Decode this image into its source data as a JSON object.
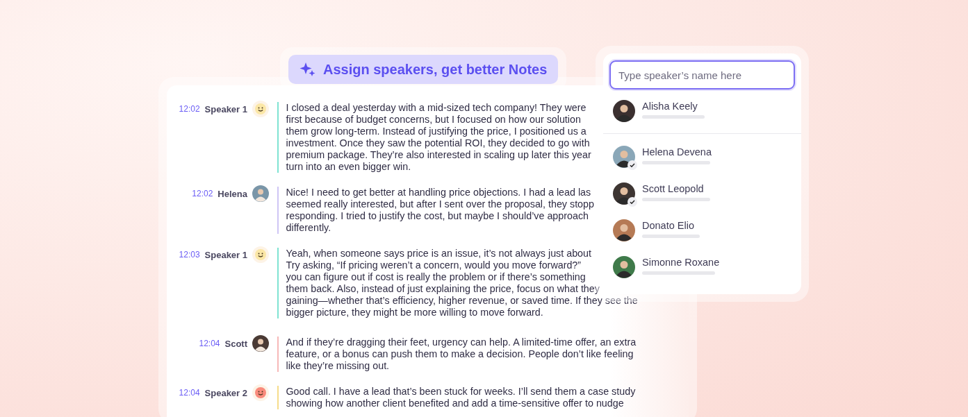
{
  "banner": {
    "text": "Assign speakers, get better Notes"
  },
  "transcript": [
    {
      "time": "12:02",
      "speaker": "Speaker 1",
      "avatar": {
        "kind": "emoji",
        "color": "#fbe7a6"
      },
      "color": "#7fe3d2",
      "lines": [
        "I closed a deal yesterday with a mid-sized tech company! They were",
        "first because of budget concerns, but I focused on how our solution",
        "them grow long-term. Instead of justifying the price, I positioned us a",
        "investment. Once they saw the potential ROI, they decided to go with",
        "premium package. They’re also interested in scaling up later this year",
        "turn into an even bigger win."
      ]
    },
    {
      "time": "12:02",
      "speaker": "Helena",
      "avatar": {
        "kind": "photo",
        "color": "#7a96a8"
      },
      "color": "#cfc6f5",
      "lines": [
        "Nice! I need to get better at handling price objections. I had a lead las",
        "seemed really interested, but after I sent over the proposal, they stopp",
        "responding. I tried to justify the cost, but maybe I should’ve approach",
        "differently."
      ]
    },
    {
      "time": "12:03",
      "speaker": "Speaker 1",
      "avatar": {
        "kind": "emoji",
        "color": "#fbe7a6"
      },
      "color": "#7fe3d2",
      "lines": [
        "Yeah, when someone says price is an issue, it’s not always just about",
        "Try asking, “If pricing weren’t a concern, would you move forward?”",
        "you can figure out if cost is really the problem or if there’s something",
        "them back. Also, instead of just explaining the price, focus on what they",
        "gaining—whether that’s efficiency, higher revenue, or saved time. If they see the",
        "bigger picture, they might be more willing to move forward."
      ]
    },
    {
      "time": "12:04",
      "speaker": "Scott",
      "avatar": {
        "kind": "photo",
        "color": "#4a3a34"
      },
      "color": "#f7b8b8",
      "lines": [
        "And if they’re dragging their feet, urgency can help. A limited-time offer, an extra",
        "feature, or a bonus can push them to make a decision. People don’t like feeling",
        "like they’re missing out."
      ]
    },
    {
      "time": "12:04",
      "speaker": "Speaker 2",
      "avatar": {
        "kind": "emoji",
        "color": "#f98b7c"
      },
      "color": "#f6dc8a",
      "lines": [
        "Good call. I have a lead that’s been stuck for weeks. I’ll send them a case study",
        "showing how another client benefited and add a time-sensitive offer to nudge"
      ]
    }
  ],
  "speaker_picker": {
    "placeholder": "Type speaker’s name here",
    "suggested": [
      {
        "name": "Alisha Keely",
        "color": "#3b3030",
        "checked": false
      }
    ],
    "speakers": [
      {
        "name": "Helena Devena",
        "color": "#8aa7b8",
        "checked": true
      },
      {
        "name": "Scott Leopold",
        "color": "#3d3532",
        "checked": true
      },
      {
        "name": "Donato Elio",
        "color": "#b57a55",
        "checked": false
      },
      {
        "name": "Simonne Roxane",
        "color": "#3f7a4a",
        "checked": false
      }
    ]
  }
}
